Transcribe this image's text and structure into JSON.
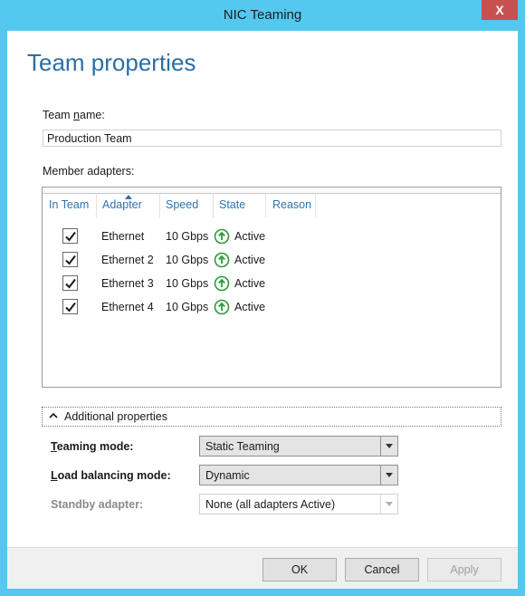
{
  "window": {
    "title": "NIC Teaming",
    "close_glyph": "X",
    "accent_color": "#54c8ee",
    "close_color": "#c75050"
  },
  "page": {
    "heading": "Team properties"
  },
  "team_name": {
    "label_pre": "Team ",
    "label_access": "n",
    "label_post": "ame:",
    "value": "Production Team"
  },
  "member_adapters": {
    "label": "Member adapters:",
    "columns": [
      "In Team",
      "Adapter",
      "Speed",
      "State",
      "Reason"
    ],
    "sorted_column": "Adapter",
    "rows": [
      {
        "in_team": true,
        "adapter": "Ethernet",
        "speed": "10 Gbps",
        "state": "Active",
        "state_icon": "up-arrow-circle-icon",
        "reason": ""
      },
      {
        "in_team": true,
        "adapter": "Ethernet 2",
        "speed": "10 Gbps",
        "state": "Active",
        "state_icon": "up-arrow-circle-icon",
        "reason": ""
      },
      {
        "in_team": true,
        "adapter": "Ethernet 3",
        "speed": "10 Gbps",
        "state": "Active",
        "state_icon": "up-arrow-circle-icon",
        "reason": ""
      },
      {
        "in_team": true,
        "adapter": "Ethernet 4",
        "speed": "10 Gbps",
        "state": "Active",
        "state_icon": "up-arrow-circle-icon",
        "reason": ""
      }
    ],
    "state_color": "#2e9a3a"
  },
  "additional": {
    "expander_label": "Additional properties",
    "expanded": true,
    "teaming_mode": {
      "label_access": "T",
      "label_rest": "eaming mode:",
      "value": "Static Teaming"
    },
    "load_balancing_mode": {
      "label_access": "L",
      "label_rest": "oad balancing mode:",
      "value": "Dynamic"
    },
    "standby_adapter": {
      "label": "Standby adapter:",
      "value": "None (all adapters Active)",
      "enabled": false
    }
  },
  "footer": {
    "ok_label": "OK",
    "cancel_label": "Cancel",
    "apply_label": "Apply",
    "apply_enabled": false
  }
}
